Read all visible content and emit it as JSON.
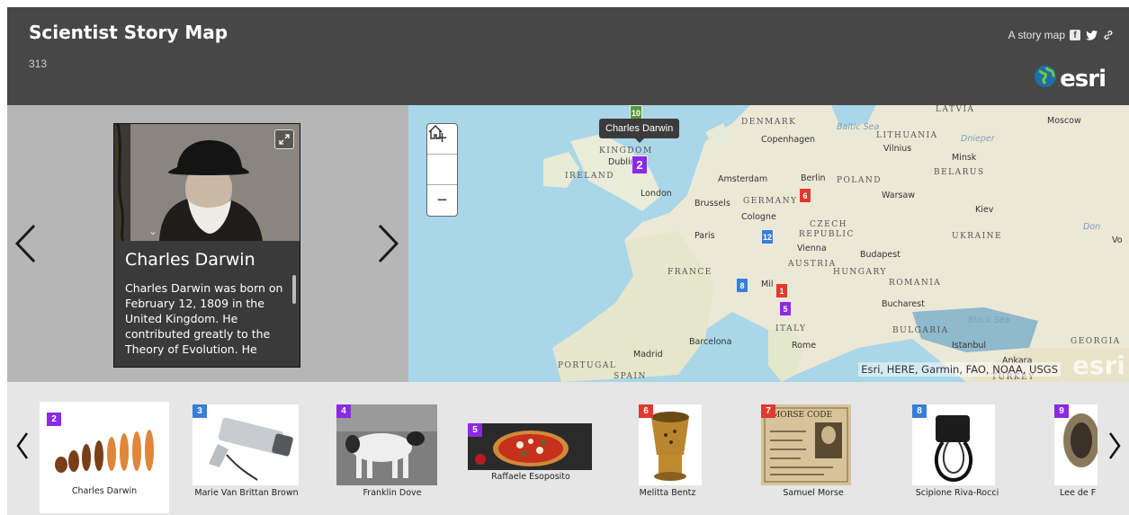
{
  "header": {
    "title": "Scientist Story Map",
    "subtitle": "313",
    "share_label": "A story map",
    "brand": "esri"
  },
  "story": {
    "name": "Charles Darwin",
    "description": "Charles Darwin was born on February 12, 1809 in the United Kingdom. He contributed greatly to the Theory of Evolution. He"
  },
  "map": {
    "tooltip": "Charles Darwin",
    "attribution": "Esri, HERE, Garmin, FAO, NOAA, USGS",
    "watermark": "esri",
    "zoom_in": "+",
    "zoom_out": "−",
    "labels": {
      "latvia": "LATVIA",
      "denmark": "DENMARK",
      "copenhagen": "Copenhagen",
      "baltic_sea": "Baltic Sea",
      "lithuania": "LITHUANIA",
      "vilnius": "Vilnius",
      "moscow": "Moscow",
      "dnieper": "Dnieper",
      "minsk": "Minsk",
      "belarus": "BELARUS",
      "kingdom": "KINGDOM",
      "dublin": "Dublin",
      "ireland": "IRELAND",
      "amsterdam": "Amsterdam",
      "berlin": "Berlin",
      "poland": "POLAND",
      "warsaw": "Warsaw",
      "london": "London",
      "brussels": "Brussels",
      "germany": "GERMANY",
      "cologne": "Cologne",
      "kiev": "Kiev",
      "czech": "CZECH",
      "republic": "REPUBLIC",
      "paris": "Paris",
      "ukraine": "UKRAINE",
      "don": "Don",
      "vienna": "Vienna",
      "budapest": "Budapest",
      "austria": "AUSTRIA",
      "france": "FRANCE",
      "hungary": "HUNGARY",
      "romania": "ROMANIA",
      "milan": "Mil",
      "bucharest": "Bucharest",
      "black_sea": "Black Sea",
      "italy": "ITALY",
      "bulgaria": "BULGARIA",
      "barcelona": "Barcelona",
      "rome": "Rome",
      "istanbul": "Istanbul",
      "georgia": "GEORGIA",
      "madrid": "Madrid",
      "portugal": "PORTUGAL",
      "spain": "SPAIN",
      "ankara": "Ankara",
      "turkey": "TURKEY",
      "volga": "Vo"
    },
    "pins": [
      {
        "num": "10",
        "color": "#5a9a3a"
      },
      {
        "num": "2",
        "color": "#8a2be2"
      },
      {
        "num": "6",
        "color": "#e03a2e"
      },
      {
        "num": "12",
        "color": "#3a7fd6"
      },
      {
        "num": "8",
        "color": "#3a7fd6"
      },
      {
        "num": "1",
        "color": "#e03a2e"
      },
      {
        "num": "5",
        "color": "#8a2be2"
      }
    ]
  },
  "carousel": {
    "items": [
      {
        "num": "2",
        "label": "Charles Darwin",
        "color": "#8a2be2"
      },
      {
        "num": "3",
        "label": "Marie Van Brittan Brown",
        "color": "#3a7fd6"
      },
      {
        "num": "4",
        "label": "Franklin Dove",
        "color": "#8a2be2"
      },
      {
        "num": "5",
        "label": "Raffaele Esoposito",
        "color": "#8a2be2"
      },
      {
        "num": "6",
        "label": "Melitta Bentz",
        "color": "#e03a2e"
      },
      {
        "num": "7",
        "label": "Samuel Morse",
        "color": "#e03a2e"
      },
      {
        "num": "8",
        "label": "Scipione Riva-Rocci",
        "color": "#3a7fd6"
      },
      {
        "num": "9",
        "label": "Lee de F",
        "color": "#8a2be2"
      }
    ],
    "morse_caption": "MORSE CODE"
  },
  "icons": {
    "prev": "prev-arrow-icon",
    "next": "next-arrow-icon",
    "home": "home-icon",
    "expand": "expand-icon",
    "facebook": "facebook-icon",
    "twitter": "twitter-icon",
    "link": "link-icon",
    "globe": "globe-icon"
  }
}
